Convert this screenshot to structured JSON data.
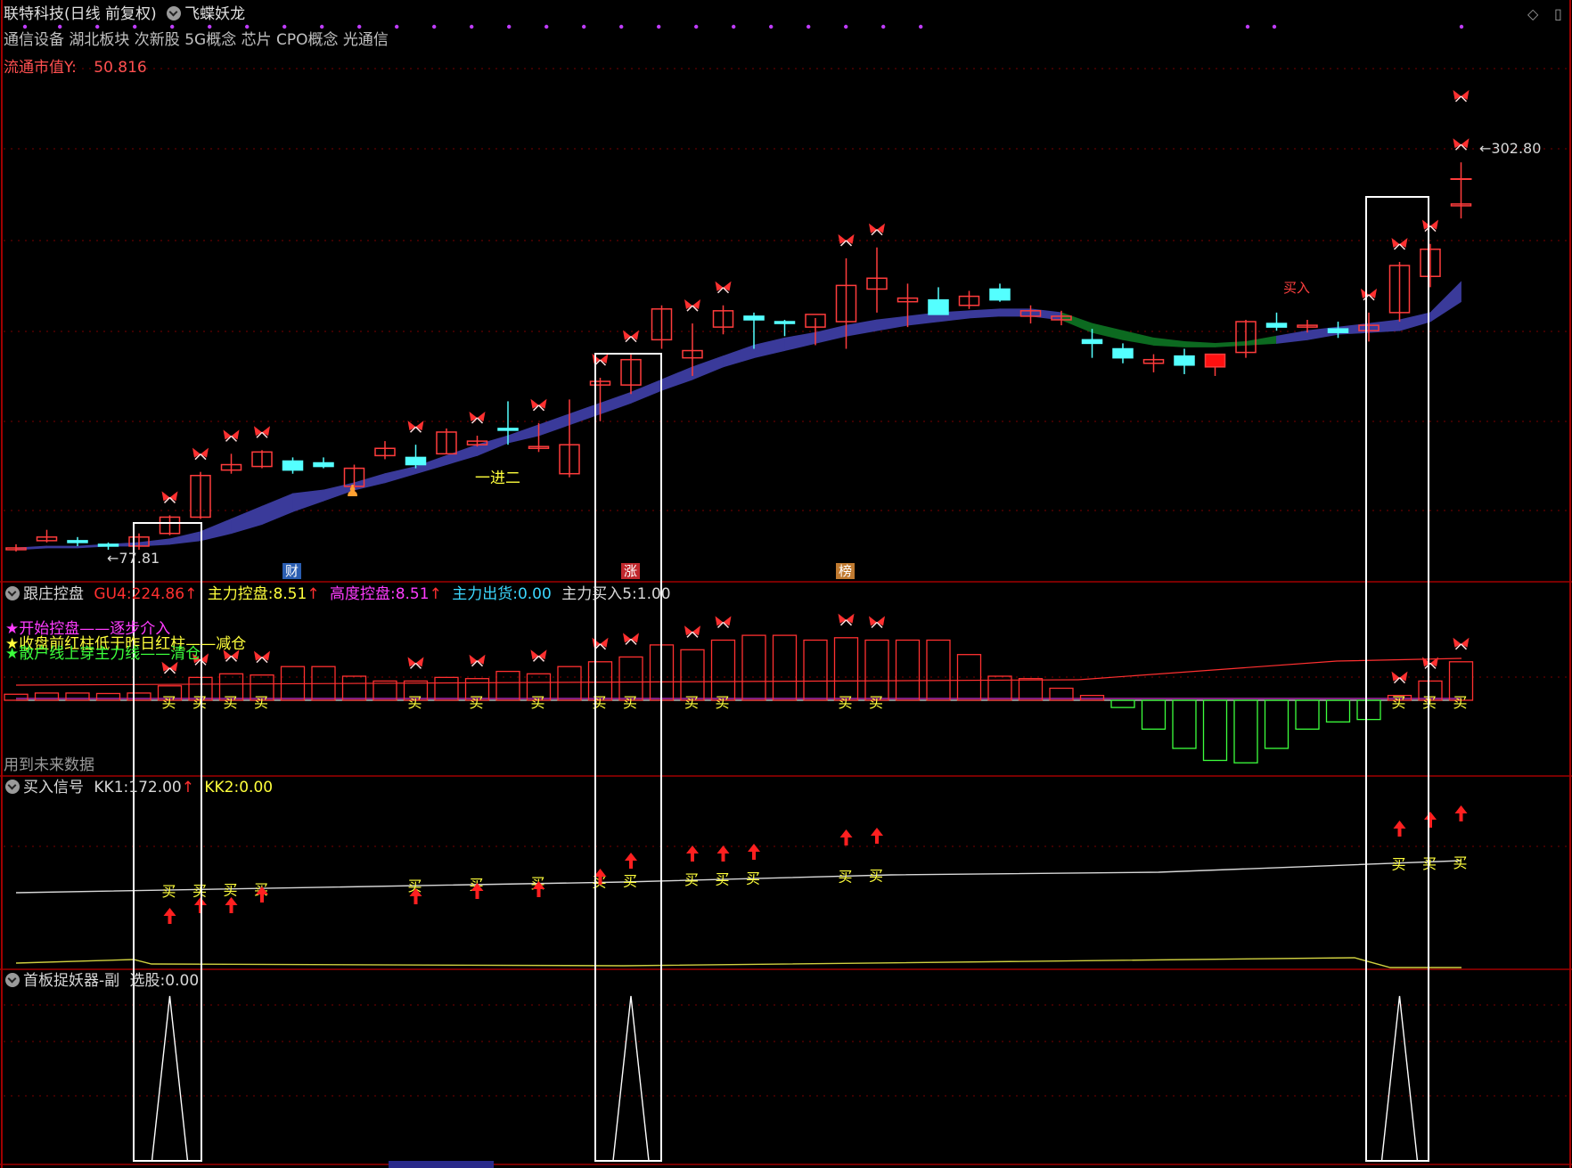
{
  "header": {
    "stock_title": "联特科技(日线 前复权)",
    "indicator_name": "飞蝶妖龙",
    "sectors": "通信设备 湖北板块 次新股 5G概念 芯片 CPO概念 光通信",
    "float_cap_label": "流通市值Y:",
    "float_cap_value": "50.816"
  },
  "main_panel": {
    "high_label": "302.80",
    "low_label": "77.81",
    "annotation_jin": "一进二",
    "annotation_buy": "买入",
    "badges": [
      {
        "text": "财",
        "bg": "#2a5db0"
      },
      {
        "text": "涨",
        "bg": "#c0282d"
      },
      {
        "text": "榜",
        "bg": "#c07a30"
      }
    ]
  },
  "panel2": {
    "title": "跟庄控盘",
    "gu4_label": "GU4:",
    "gu4_value": "224.86",
    "zhuli_label": "主力控盘:",
    "zhuli_value": "8.51",
    "gaodu_label": "高度控盘:",
    "gaodu_value": "8.51",
    "chuhuo_label": "主力出货:",
    "chuhuo_value": "0.00",
    "mairu_label": "主力买入5:",
    "mairu_value": "1.00",
    "legend1": "★开始控盘——逐步介入",
    "legend2": "★收盘前红柱低于昨日红柱——减仓",
    "legend3": "★散户线上穿主力线——清仓",
    "future_data": "用到未来数据"
  },
  "panel3": {
    "title": "买入信号",
    "kk1_label": "KK1:",
    "kk1_value": "172.00",
    "kk2_label": "KK2:",
    "kk2_value": "0.00"
  },
  "panel4": {
    "title": "首板捉妖器-副",
    "xuangu_label": "选股:",
    "xuangu_value": "0.00"
  },
  "buy_char": "买",
  "colors": {
    "bg": "#000000",
    "up": "#ff3c3c",
    "down": "#54ffff",
    "grid": "#7a0000",
    "divider": "#a00000",
    "band_up": "#3a3a9a",
    "band_down": "#0c6a20",
    "yellow": "#ffff3c",
    "magenta": "#ff3cff",
    "green": "#3cff3c"
  },
  "chart_data": {
    "type": "candlestick",
    "ohlc": [
      [
        80,
        82,
        78,
        80
      ],
      [
        84,
        90,
        83,
        86
      ],
      [
        84,
        86,
        81,
        83
      ],
      [
        82,
        83,
        79,
        81
      ],
      [
        81,
        88,
        79,
        86
      ],
      [
        88,
        98,
        87,
        97
      ],
      [
        97,
        122,
        96,
        120
      ],
      [
        123,
        132,
        121,
        126
      ],
      [
        125,
        134,
        124,
        133
      ],
      [
        128,
        130,
        121,
        123
      ],
      [
        127,
        130,
        124,
        125
      ],
      [
        114,
        126,
        110,
        124
      ],
      [
        131,
        139,
        129,
        135
      ],
      [
        130,
        137,
        124,
        126
      ],
      [
        132,
        146,
        132,
        144
      ],
      [
        137,
        142,
        136,
        139
      ],
      [
        146,
        161,
        137,
        145
      ],
      [
        136,
        149,
        133,
        136
      ],
      [
        121,
        162,
        119,
        137
      ],
      [
        170,
        174,
        150,
        172
      ],
      [
        170,
        187,
        165,
        184
      ],
      [
        195,
        214,
        190,
        212
      ],
      [
        185,
        204,
        175,
        189
      ],
      [
        202,
        214,
        198,
        211
      ],
      [
        208,
        210,
        190,
        206
      ],
      [
        205,
        206,
        197,
        204
      ],
      [
        202,
        207,
        192,
        209
      ],
      [
        205,
        240,
        190,
        225
      ],
      [
        223,
        246,
        210,
        229
      ],
      [
        216,
        226,
        202,
        218
      ],
      [
        217,
        224,
        210,
        209
      ],
      [
        214,
        222,
        212,
        219
      ],
      [
        223,
        226,
        216,
        217
      ],
      [
        208,
        214,
        204,
        211
      ],
      [
        206,
        211,
        203,
        208
      ],
      [
        195,
        201,
        185,
        193
      ],
      [
        190,
        193,
        182,
        185
      ],
      [
        182,
        187,
        177,
        184
      ],
      [
        186,
        190,
        176,
        181
      ],
      [
        180,
        185,
        175,
        187
      ],
      [
        188,
        206,
        185,
        205
      ],
      [
        204,
        210,
        200,
        202
      ],
      [
        202,
        206,
        199,
        203
      ],
      [
        201,
        205,
        196,
        199
      ],
      [
        200,
        210,
        194,
        203
      ],
      [
        210,
        238,
        205,
        236
      ],
      [
        230,
        248,
        224,
        245
      ],
      [
        270,
        293,
        262,
        270
      ]
    ],
    "band_top": [
      80,
      81,
      81,
      82,
      83,
      85,
      89,
      96,
      103,
      110,
      112,
      116,
      121,
      125,
      131,
      137,
      142,
      148,
      154,
      160,
      166,
      173,
      180,
      186,
      192,
      196,
      199,
      203,
      206,
      208,
      210,
      211,
      212,
      212,
      210,
      204,
      200,
      196,
      194,
      193,
      194,
      197,
      200,
      202,
      204,
      206,
      210,
      227
    ],
    "band_bottom": [
      79,
      80,
      80,
      81,
      81,
      82,
      84,
      88,
      93,
      100,
      106,
      112,
      116,
      121,
      126,
      131,
      138,
      142,
      148,
      154,
      160,
      167,
      173,
      180,
      185,
      189,
      193,
      197,
      200,
      203,
      205,
      207,
      208,
      208,
      206,
      199,
      195,
      192,
      191,
      191,
      192,
      193,
      195,
      198,
      199,
      200,
      205,
      216
    ],
    "turnover_bars": [
      0.25,
      0.3,
      0.3,
      0.28,
      0.3,
      0.6,
      0.95,
      1.1,
      1.05,
      1.4,
      1.4,
      1.0,
      0.8,
      0.8,
      0.95,
      0.9,
      1.2,
      1.1,
      1.4,
      1.6,
      1.8,
      2.3,
      2.1,
      2.5,
      2.7,
      2.7,
      2.5,
      2.6,
      2.5,
      2.5,
      2.5,
      1.9,
      1.0,
      0.9,
      0.5,
      0.2,
      -0.3,
      -1.2,
      -2.0,
      -2.5,
      -2.6,
      -2.0,
      -1.2,
      -0.9,
      -0.8,
      0.2,
      0.8,
      1.6
    ],
    "kk1_line_start": 172,
    "kk2_line": 0,
    "xuangu_signals": [
      5,
      20,
      45
    ]
  }
}
